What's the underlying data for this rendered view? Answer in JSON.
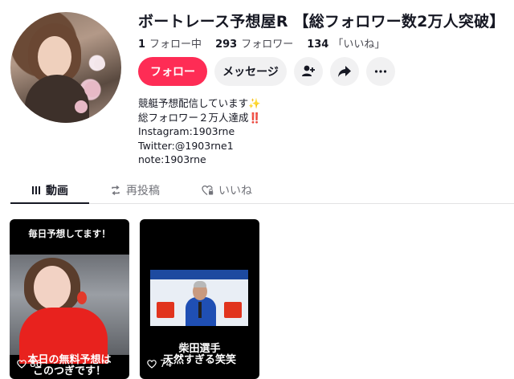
{
  "profile": {
    "title": "ボートレース予想屋R 【総フォロワー数2万人突破】",
    "stats": {
      "following_count": "1",
      "following_label": "フォロー中",
      "followers_count": "293",
      "followers_label": "フォロワー",
      "likes_count": "134",
      "likes_label": "「いいね」"
    },
    "bio": [
      "競艇予想配信しています✨",
      "総フォロワー２万人達成‼️",
      "Instagram:1903rne",
      "Twitter:@1903rne1",
      "note:1903rne"
    ]
  },
  "actions": {
    "follow_label": "フォロー",
    "message_label": "メッセージ",
    "icons": [
      "add-user-icon",
      "share-icon",
      "more-icon"
    ]
  },
  "tabs": [
    {
      "label": "動画",
      "icon": "grid-icon",
      "active": true
    },
    {
      "label": "再投稿",
      "icon": "repost-icon",
      "active": false
    },
    {
      "label": "いいね",
      "icon": "heart-lock-icon",
      "active": false
    }
  ],
  "videos": [
    {
      "caption_top": "毎日予想してます！",
      "caption_bottom_1": "本日の無料予想は",
      "caption_bottom_2": "このつぎです！",
      "likes": "86"
    },
    {
      "caption_top": "",
      "caption_bottom_1": "柴田選手",
      "caption_bottom_2": "天然すぎる笑笑",
      "likes": "74"
    }
  ],
  "colors": {
    "accent": "#fe2c55",
    "text": "#161823",
    "secondary_bg": "#f1f1f2"
  }
}
